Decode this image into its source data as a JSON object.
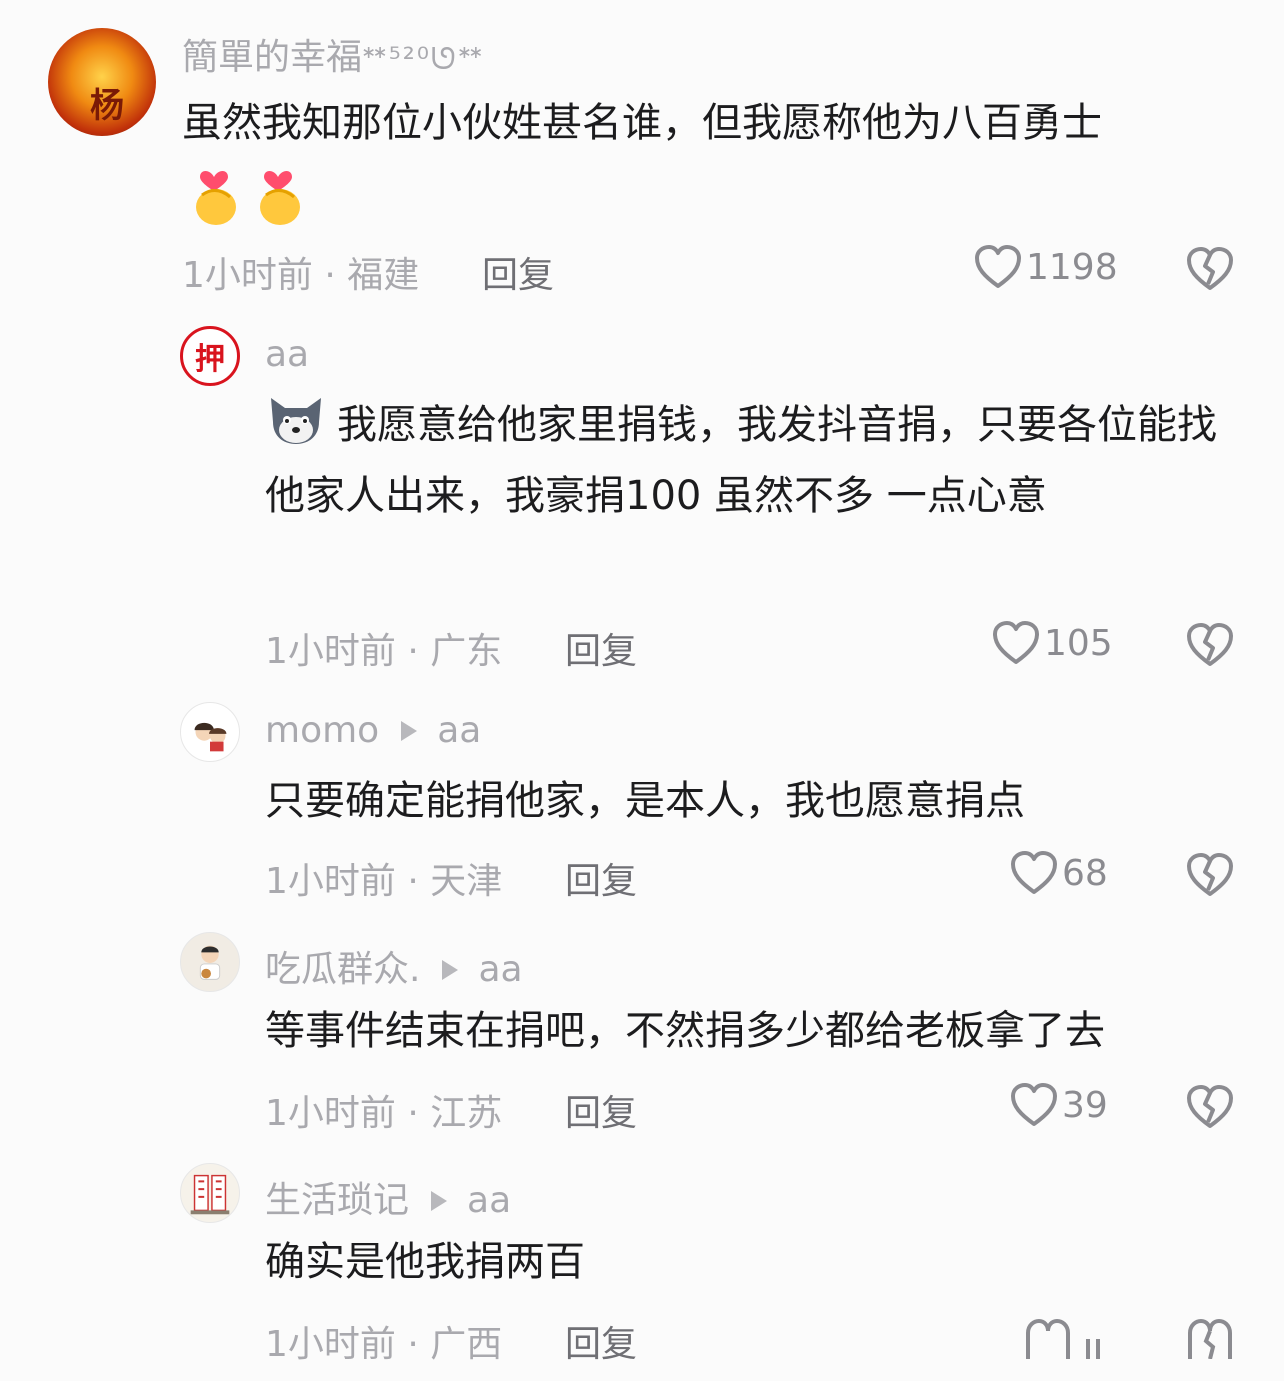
{
  "comments": [
    {
      "username": "簡單的幸福",
      "username_suffix": "ᕯ⁵²⁰ᘎᕯ",
      "reply_to": "",
      "text": "虽然我知那位小伙姓甚名谁，但我愿称他为八百勇士",
      "time_location": "1小时前 · 福建",
      "reply_label": "回复",
      "likes": "1198",
      "avatar_glyph": "杨"
    },
    {
      "username": "aa",
      "reply_to": "",
      "text": "我愿意给他家里捐钱，我发抖音捐，只要各位能找他家人出来，我豪捐100 虽然不多  一点心意",
      "time_location": "1小时前 · 广东",
      "reply_label": "回复",
      "likes": "105",
      "avatar_glyph": "押"
    },
    {
      "username": "momo",
      "reply_to": "aa",
      "text": "只要确定能捐他家，是本人，我也愿意捐点",
      "time_location": "1小时前 · 天津",
      "reply_label": "回复",
      "likes": "68"
    },
    {
      "username": "吃瓜群众.",
      "reply_to": "aa",
      "text": "等事件结束在捐吧，不然捐多少都给老板拿了去",
      "time_location": "1小时前 · 江苏",
      "reply_label": "回复",
      "likes": "39"
    },
    {
      "username": "生活琐记",
      "reply_to": "aa",
      "text": "确实是他我捐两百",
      "time_location": "1小时前 · 广西",
      "reply_label": "回复",
      "likes": ""
    }
  ],
  "colors": {
    "background": "#fbfbfb",
    "text": "#1c1c1e",
    "muted": "#a9a9ae",
    "icon": "#8b8b90"
  },
  "icons": [
    "heart-outline-icon",
    "broken-heart-icon",
    "finger-heart-emoji",
    "wolf-emoji",
    "play-arrow-icon"
  ]
}
